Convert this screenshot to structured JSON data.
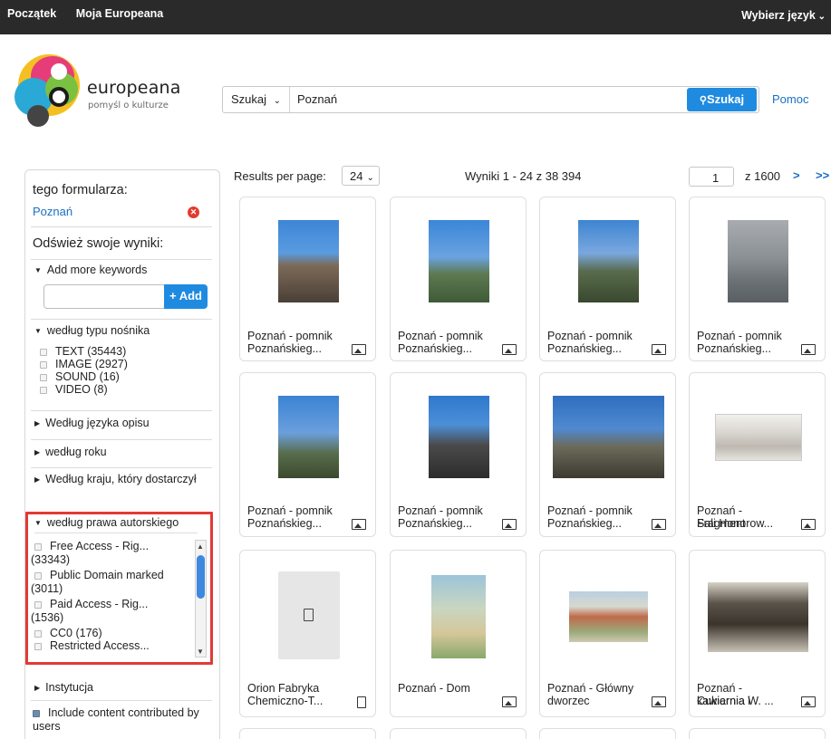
{
  "topbar": {
    "home": "Początek",
    "my": "Moja Europeana",
    "language": "Wybierz język"
  },
  "header": {
    "brand": "europeana",
    "tagline": "pomyśl o kulturze",
    "search_scope": "Szukaj",
    "search_query": "Poznań",
    "search_button": "Szukaj",
    "help_link": "Pomoc"
  },
  "sidebar": {
    "form_title": "tego formularza:",
    "active_term": "Poznań",
    "refine_title": "Odśwież swoje wyniki:",
    "keywords_label": "Add more keywords",
    "keywords_value": "",
    "keywords_button": "+ Add",
    "media_type_label": "według typu nośnika",
    "media_types": [
      "TEXT (35443)",
      "IMAGE (2927)",
      "SOUND (16)",
      "VIDEO (8)"
    ],
    "language_label": "Według języka opisu",
    "year_label": "według roku",
    "country_label": "Według kraju, który dostarczył",
    "rights_label": "według prawa autorskiego",
    "rights": [
      "Free Access - Rig...",
      "(33343)",
      "Public Domain marked",
      "(3011)",
      "Paid Access - Rig...",
      "(1536)",
      "CC0 (176)",
      "Restricted Access..."
    ],
    "institution_label": "Instytucja",
    "ugc_label": "Include content contributed by users"
  },
  "results": {
    "per_page_label": "Results per page:",
    "per_page_value": "24",
    "count_text": "Wyniki 1 - 24 z 38 394",
    "page_value": "1",
    "page_total": "z 1600",
    "next": ">",
    "last": ">>",
    "items": [
      {
        "line1": "Poznań - pomnik",
        "line2": "Poznańskieg...",
        "type_icon": "image-icon"
      },
      {
        "line1": "Poznań - pomnik",
        "line2": "Poznańskieg...",
        "type_icon": "image-icon"
      },
      {
        "line1": "Poznań - pomnik",
        "line2": "Poznańskieg...",
        "type_icon": "image-icon"
      },
      {
        "line1": "Poznań - pomnik",
        "line2": "Poznańskieg...",
        "type_icon": "image-icon"
      },
      {
        "line1": "Poznań - pomnik",
        "line2": "Poznańskieg...",
        "type_icon": "image-icon"
      },
      {
        "line1": "Poznań - pomnik",
        "line2": "Poznańskieg...",
        "type_icon": "image-icon"
      },
      {
        "line1": "Poznań - pomnik",
        "line2": "Poznańskieg...",
        "type_icon": "image-icon"
      },
      {
        "line1": "Poznań - Fragment",
        "line2": "Sali Honorow...",
        "type_icon": "image-icon"
      },
      {
        "line1": "Orion Fabryka",
        "line2": "Chemiczno-T...",
        "type_icon": "text-icon"
      },
      {
        "line1": "Poznań - Dom",
        "line2": "",
        "type_icon": "image-icon"
      },
      {
        "line1": "Poznań - Główny",
        "line2": "dworzec",
        "type_icon": "image-icon"
      },
      {
        "line1": "Poznań - Cukiernia i",
        "line2": "kawiarnia W. ...",
        "type_icon": "image-icon"
      }
    ]
  },
  "colors": {
    "topbar": "#2a2a2a",
    "accent": "#1f8be0",
    "link": "#1a6fc4",
    "highlight": "#e23a35"
  }
}
